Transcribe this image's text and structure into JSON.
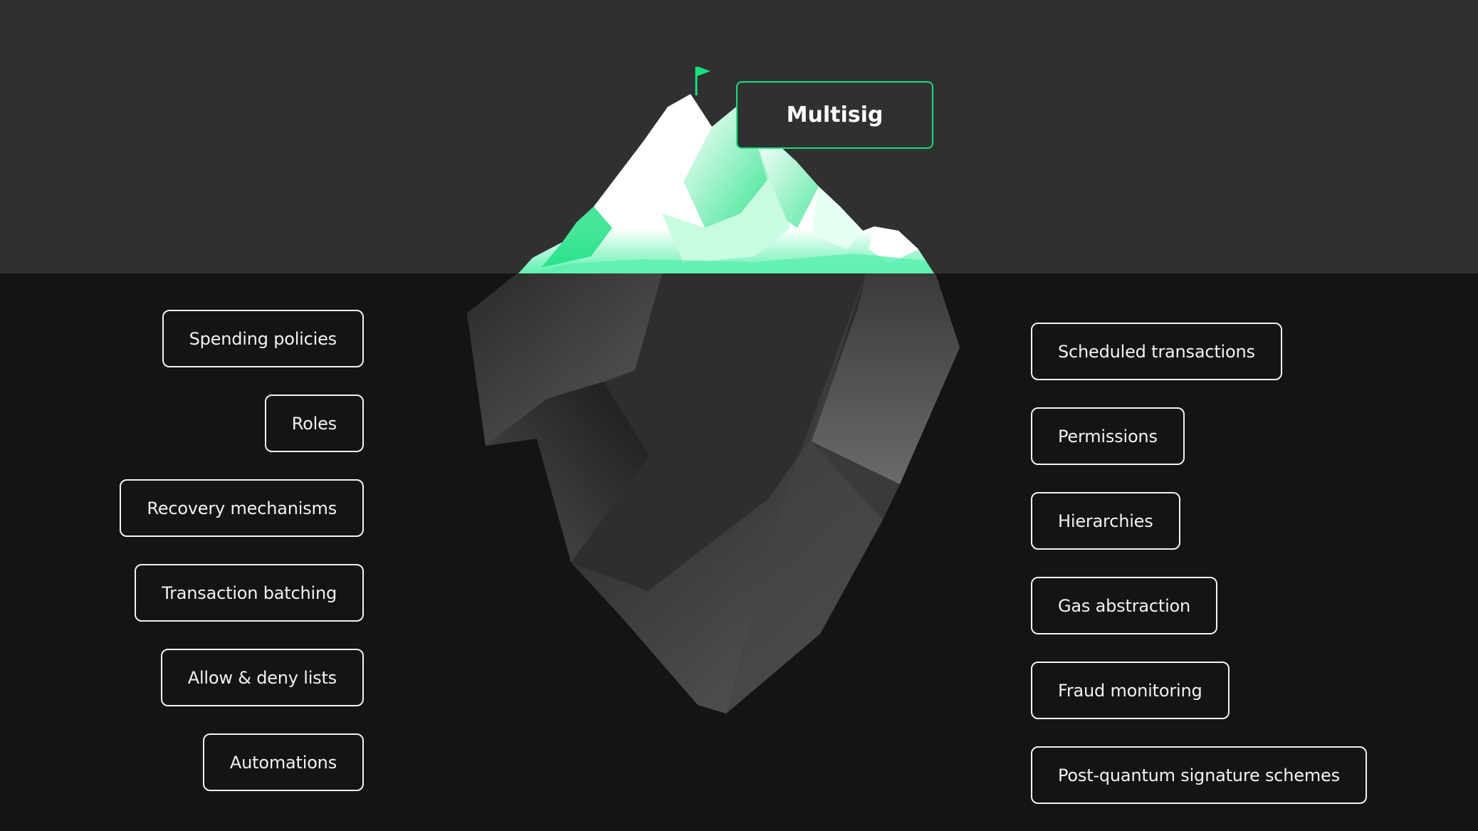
{
  "diagram": {
    "top_label": "Multisig",
    "left_items": [
      "Spending policies",
      "Roles",
      "Recovery mechanisms",
      "Transaction batching",
      "Allow & deny lists",
      "Automations"
    ],
    "right_items": [
      "Scheduled transactions",
      "Permissions",
      "Hierarchies",
      "Gas abstraction",
      "Fraud monitoring",
      "Post-quantum signature schemes"
    ]
  },
  "colors": {
    "sky": "#303032",
    "sea": "#141414",
    "accent": "#16e07f",
    "box_border": "#f2f2f2"
  },
  "icons": [
    "flag-icon"
  ]
}
